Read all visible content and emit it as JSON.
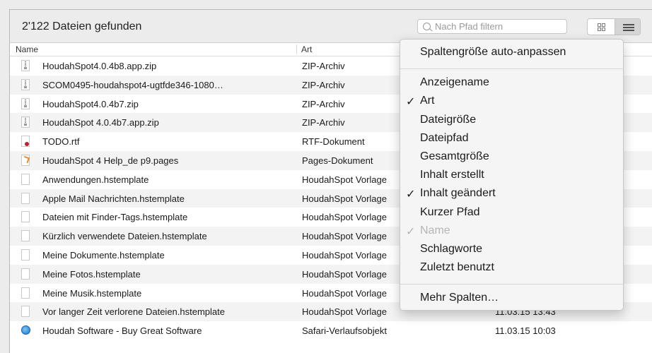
{
  "toolbar": {
    "result_count": "2'122 Dateien gefunden",
    "filter_placeholder": "Nach Pfad filtern"
  },
  "columns": {
    "name": "Name",
    "type": "Art"
  },
  "files": [
    {
      "name": "HoudahSpot4.0.4b8.app.zip",
      "type": "ZIP-Archiv",
      "date": "",
      "icon": "zip-file-icon"
    },
    {
      "name": "SCOM0495-houdahspot4-ugtfde346-1080…",
      "type": "ZIP-Archiv",
      "date": "",
      "icon": "zip-file-icon"
    },
    {
      "name": "HoudahSpot4.0.4b7.zip",
      "type": "ZIP-Archiv",
      "date": "",
      "icon": "zip-file-icon"
    },
    {
      "name": "HoudahSpot 4.0.4b7.app.zip",
      "type": "ZIP-Archiv",
      "date": "",
      "icon": "zip-file-icon"
    },
    {
      "name": "TODO.rtf",
      "type": "RTF-Dokument",
      "date": "",
      "icon": "rtf-file-icon"
    },
    {
      "name": "HoudahSpot 4 Help_de p9.pages",
      "type": "Pages-Dokument",
      "date": "",
      "icon": "pages-file-icon"
    },
    {
      "name": "Anwendungen.hstemplate",
      "type": "HoudahSpot Vorlage",
      "date": "",
      "icon": "document-icon"
    },
    {
      "name": "Apple Mail Nachrichten.hstemplate",
      "type": "HoudahSpot Vorlage",
      "date": "",
      "icon": "document-icon"
    },
    {
      "name": "Dateien mit Finder-Tags.hstemplate",
      "type": "HoudahSpot Vorlage",
      "date": "",
      "icon": "document-icon"
    },
    {
      "name": "Kürzlich verwendete Dateien.hstemplate",
      "type": "HoudahSpot Vorlage",
      "date": "",
      "icon": "document-icon"
    },
    {
      "name": "Meine Dokumente.hstemplate",
      "type": "HoudahSpot Vorlage",
      "date": "",
      "icon": "document-icon"
    },
    {
      "name": "Meine Fotos.hstemplate",
      "type": "HoudahSpot Vorlage",
      "date": "",
      "icon": "document-icon"
    },
    {
      "name": "Meine Musik.hstemplate",
      "type": "HoudahSpot Vorlage",
      "date": "",
      "icon": "document-icon"
    },
    {
      "name": "Vor langer Zeit verlorene Dateien.hstemplate",
      "type": "HoudahSpot Vorlage",
      "date": "11.03.15 13:43",
      "icon": "document-icon"
    },
    {
      "name": "Houdah Software - Buy Great Software",
      "type": "Safari-Verlaufsobjekt",
      "date": "11.03.15 10:03",
      "icon": "safari-history-icon"
    }
  ],
  "menu": {
    "autosize": "Spaltengröße auto-anpassen",
    "items": [
      {
        "label": "Anzeigename",
        "checked": false,
        "disabled": false
      },
      {
        "label": "Art",
        "checked": true,
        "disabled": false
      },
      {
        "label": "Dateigröße",
        "checked": false,
        "disabled": false
      },
      {
        "label": "Dateipfad",
        "checked": false,
        "disabled": false
      },
      {
        "label": "Gesamtgröße",
        "checked": false,
        "disabled": false
      },
      {
        "label": "Inhalt erstellt",
        "checked": false,
        "disabled": false
      },
      {
        "label": "Inhalt geändert",
        "checked": true,
        "disabled": false
      },
      {
        "label": "Kurzer Pfad",
        "checked": false,
        "disabled": false
      },
      {
        "label": "Name",
        "checked": true,
        "disabled": true
      },
      {
        "label": "Schlagworte",
        "checked": false,
        "disabled": false
      },
      {
        "label": "Zuletzt benutzt",
        "checked": false,
        "disabled": false
      }
    ],
    "more": "Mehr Spalten…",
    "check_glyph": "✓"
  }
}
